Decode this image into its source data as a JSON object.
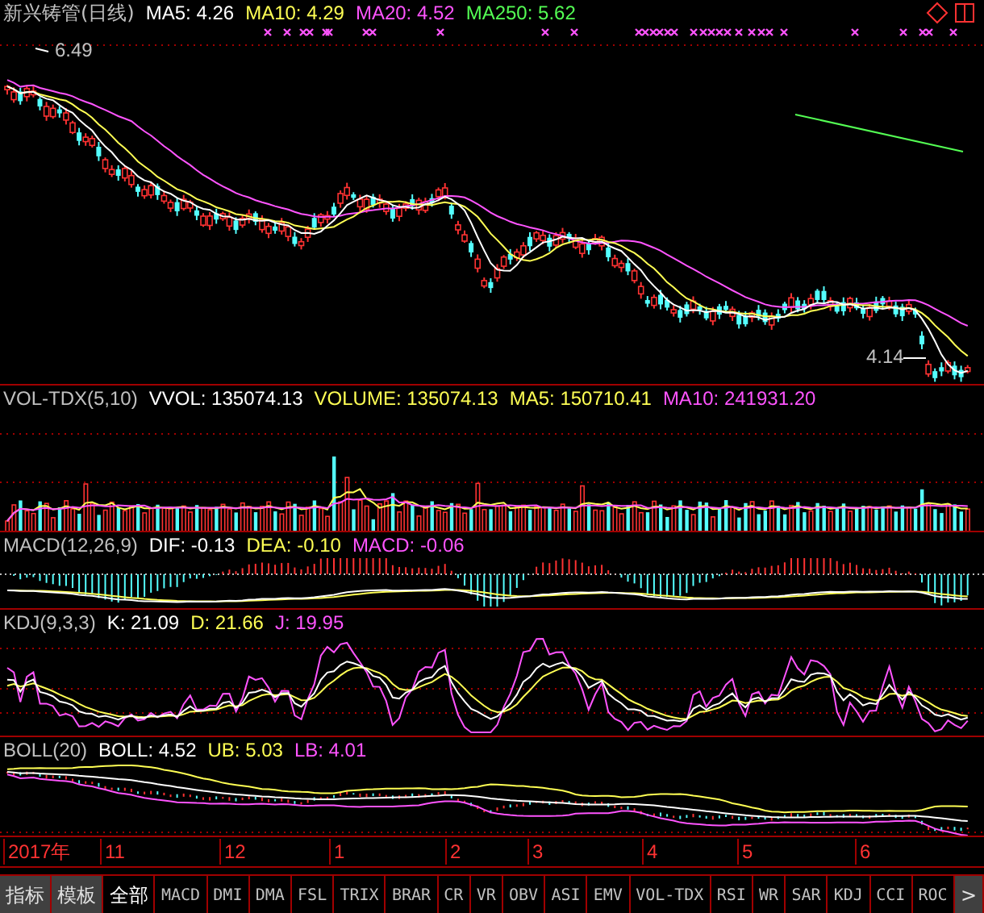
{
  "main_pane": {
    "title": "新兴铸管(日线)",
    "indicators": [
      {
        "text": "MA5: 4.26",
        "color": "#ffffff"
      },
      {
        "text": "MA10: 4.29",
        "color": "#ffff54"
      },
      {
        "text": "MA20: 4.52",
        "color": "#ff54ff"
      },
      {
        "text": "MA250: 5.62",
        "color": "#54ff54"
      }
    ],
    "high_label": "6.49",
    "low_label": "4.14"
  },
  "indicator_panes": [
    {
      "kind": "volume",
      "title": "VOL-TDX(5,10)",
      "values": [
        {
          "text": "VVOL: 135074.13",
          "color": "#ffffff"
        },
        {
          "text": "VOLUME: 135074.13",
          "color": "#ffff54"
        },
        {
          "text": "MA5: 150710.41",
          "color": "#ffff54"
        },
        {
          "text": "MA10: 241931.20",
          "color": "#ff54ff"
        }
      ]
    },
    {
      "kind": "macd",
      "title": "MACD(12,26,9)",
      "values": [
        {
          "text": "DIF: -0.13",
          "color": "#ffffff"
        },
        {
          "text": "DEA: -0.10",
          "color": "#ffff54"
        },
        {
          "text": "MACD: -0.06",
          "color": "#ff54ff"
        }
      ]
    },
    {
      "kind": "kdj",
      "title": "KDJ(9,3,3)",
      "values": [
        {
          "text": "K: 21.09",
          "color": "#ffffff"
        },
        {
          "text": "D: 21.66",
          "color": "#ffff54"
        },
        {
          "text": "J: 19.95",
          "color": "#ff54ff"
        }
      ]
    },
    {
      "kind": "boll",
      "title": "BOLL(20)",
      "values": [
        {
          "text": "BOLL: 4.52",
          "color": "#ffffff"
        },
        {
          "text": "UB: 5.03",
          "color": "#ffff54"
        },
        {
          "text": "LB: 4.01",
          "color": "#ff54ff"
        }
      ]
    }
  ],
  "time_axis": [
    "2017年",
    "11",
    "12",
    "1",
    "2",
    "3",
    "4",
    "5",
    "6"
  ],
  "bottom_bar": [
    {
      "label": "指标",
      "kind": "button"
    },
    {
      "label": "模板",
      "kind": "button"
    },
    {
      "label": "全部",
      "kind": "tab",
      "selected": true
    },
    {
      "label": "MACD",
      "kind": "tab",
      "selected": false
    },
    {
      "label": "DMI",
      "kind": "tab",
      "selected": false
    },
    {
      "label": "DMA",
      "kind": "tab",
      "selected": false
    },
    {
      "label": "FSL",
      "kind": "tab",
      "selected": false
    },
    {
      "label": "TRIX",
      "kind": "tab",
      "selected": false
    },
    {
      "label": "BRAR",
      "kind": "tab",
      "selected": false
    },
    {
      "label": "CR",
      "kind": "tab",
      "selected": false
    },
    {
      "label": "VR",
      "kind": "tab",
      "selected": false
    },
    {
      "label": "OBV",
      "kind": "tab",
      "selected": false
    },
    {
      "label": "ASI",
      "kind": "tab",
      "selected": false
    },
    {
      "label": "EMV",
      "kind": "tab",
      "selected": false
    },
    {
      "label": "VOL-TDX",
      "kind": "tab",
      "selected": false
    },
    {
      "label": "RSI",
      "kind": "tab",
      "selected": false
    },
    {
      "label": "WR",
      "kind": "tab",
      "selected": false
    },
    {
      "label": "SAR",
      "kind": "tab",
      "selected": false
    },
    {
      "label": "KDJ",
      "kind": "tab",
      "selected": false
    },
    {
      "label": "CCI",
      "kind": "tab",
      "selected": false
    },
    {
      "label": "ROC",
      "kind": "tab",
      "selected": false
    },
    {
      "label": ">",
      "kind": "button"
    }
  ]
}
